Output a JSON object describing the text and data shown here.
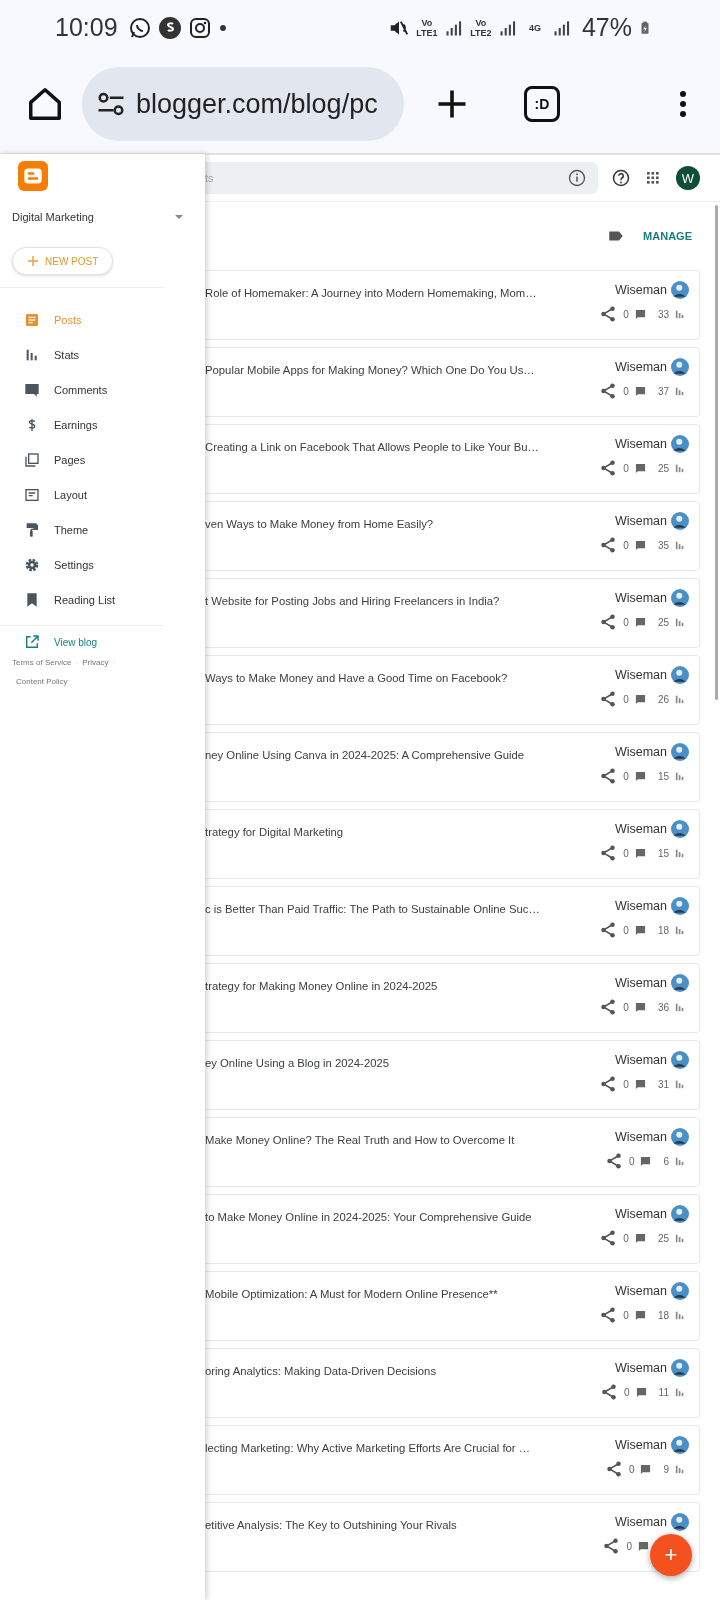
{
  "status_bar": {
    "time": "10:09",
    "network": [
      "Vo LTE1",
      "Vo LTE2",
      "4G"
    ],
    "battery": "47%"
  },
  "browser": {
    "url": "blogger.com/blog/pc",
    "tab_label": ":D"
  },
  "sidebar": {
    "blog_name": "Digital Marketing",
    "new_post": "NEW POST",
    "items": [
      {
        "label": "Posts",
        "selected": true
      },
      {
        "label": "Stats",
        "selected": false
      },
      {
        "label": "Comments",
        "selected": false
      },
      {
        "label": "Earnings",
        "selected": false
      },
      {
        "label": "Pages",
        "selected": false
      },
      {
        "label": "Layout",
        "selected": false
      },
      {
        "label": "Theme",
        "selected": false
      },
      {
        "label": "Settings",
        "selected": false
      },
      {
        "label": "Reading List",
        "selected": false
      }
    ],
    "view_blog": "View blog",
    "footer_links": [
      "Terms of Service",
      "Privacy",
      "Content Policy"
    ],
    "footer_separators": [
      "·",
      "·"
    ]
  },
  "header": {
    "search": {
      "placeholder": "ts"
    },
    "avatar": "W"
  },
  "toolbar": {
    "manage": "MANAGE"
  },
  "posts": [
    {
      "title": "Role of Homemaker: A Journey into Modern Homemaking, Mom…",
      "author": "Wiseman",
      "comments": "0",
      "views": "33"
    },
    {
      "title": "Popular Mobile Apps for Making Money? Which One Do You Us…",
      "author": "Wiseman",
      "comments": "0",
      "views": "37"
    },
    {
      "title": "Creating a Link on Facebook That Allows People to Like Your Bu…",
      "author": "Wiseman",
      "comments": "0",
      "views": "25"
    },
    {
      "title": "ven Ways to Make Money from Home Easily?",
      "author": "Wiseman",
      "comments": "0",
      "views": "35"
    },
    {
      "title": "t Website for Posting Jobs and Hiring Freelancers in India?",
      "author": "Wiseman",
      "comments": "0",
      "views": "25"
    },
    {
      "title": "Ways to Make Money and Have a Good Time on Facebook?",
      "author": "Wiseman",
      "comments": "0",
      "views": "26"
    },
    {
      "title": "ney Online Using Canva in 2024-2025: A Comprehensive Guide",
      "author": "Wiseman",
      "comments": "0",
      "views": "15"
    },
    {
      "title": "trategy for Digital Marketing",
      "author": "Wiseman",
      "comments": "0",
      "views": "15"
    },
    {
      "title": "c is Better Than Paid Traffic: The Path to Sustainable Online Suc…",
      "author": "Wiseman",
      "comments": "0",
      "views": "18"
    },
    {
      "title": "trategy for Making Money Online in 2024-2025",
      "author": "Wiseman",
      "comments": "0",
      "views": "36"
    },
    {
      "title": "ey Online Using a Blog in 2024-2025",
      "author": "Wiseman",
      "comments": "0",
      "views": "31"
    },
    {
      "title": "Make Money Online? The Real Truth and How to Overcome It",
      "author": "Wiseman",
      "comments": "0",
      "views": "6"
    },
    {
      "title": "to Make Money Online in 2024-2025: Your Comprehensive Guide",
      "author": "Wiseman",
      "comments": "0",
      "views": "25"
    },
    {
      "title": "Mobile Optimization: A Must for Modern Online Presence**",
      "author": "Wiseman",
      "comments": "0",
      "views": "18"
    },
    {
      "title": "oring Analytics: Making Data-Driven Decisions",
      "author": "Wiseman",
      "comments": "0",
      "views": "11"
    },
    {
      "title": "lecting Marketing: Why Active Marketing Efforts Are Crucial for …",
      "author": "Wiseman",
      "comments": "0",
      "views": "9"
    },
    {
      "title": "etitive Analysis: The Key to Outshining Your Rivals",
      "author": "Wiseman",
      "comments": "0"
    }
  ],
  "fab": "+"
}
